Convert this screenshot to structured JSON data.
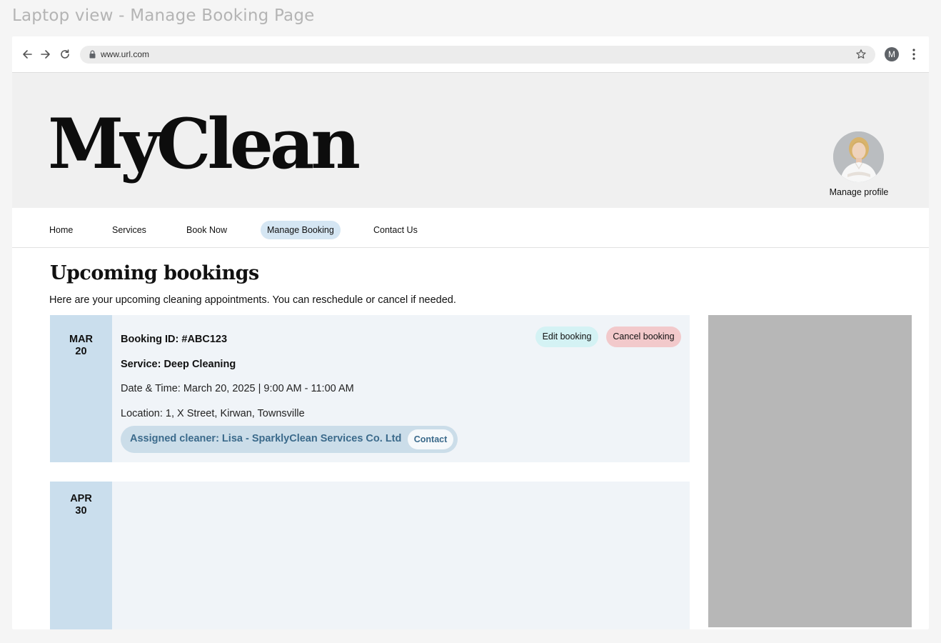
{
  "frame": {
    "title": "Laptop view - Manage Booking Page"
  },
  "browser": {
    "url": "www.url.com",
    "profile_initial": "M",
    "icons": [
      "arrow-left-icon",
      "arrow-right-icon",
      "reload-icon",
      "lock-icon",
      "star-icon",
      "kebab-menu-icon"
    ]
  },
  "site": {
    "logo": "MyClean",
    "manage_profile_label": "Manage profile"
  },
  "nav": {
    "items": [
      {
        "label": "Home",
        "active": false
      },
      {
        "label": "Services",
        "active": false
      },
      {
        "label": "Book Now",
        "active": false
      },
      {
        "label": "Manage Booking",
        "active": true
      },
      {
        "label": "Contact Us",
        "active": false
      }
    ]
  },
  "main": {
    "heading": "Upcoming bookings",
    "description": "Here are your upcoming cleaning appointments. You can reschedule or cancel if needed."
  },
  "bookings": [
    {
      "month": "MAR",
      "day": "20",
      "booking_id": "Booking ID: #ABC123",
      "service": "Service: Deep Cleaning",
      "datetime": "Date & Time: March 20, 2025 | 9:00 AM - 11:00 AM",
      "location": "Location: 1, X Street, Kirwan, Townsville",
      "cleaner": "Assigned cleaner: Lisa - SparklyClean Services Co. Ltd",
      "contact_label": "Contact",
      "edit_label": "Edit booking",
      "cancel_label": "Cancel booking"
    },
    {
      "month": "APR",
      "day": "30"
    }
  ],
  "colors": {
    "date_column": "#cadeed",
    "card_background": "#f0f4f8",
    "edit_button": "#d4f2f4",
    "cancel_button": "#f2c9cb",
    "cleaner_text": "#3b6a8b",
    "active_nav": "#d5e6f3",
    "side_panel": "#b7b7b7"
  }
}
